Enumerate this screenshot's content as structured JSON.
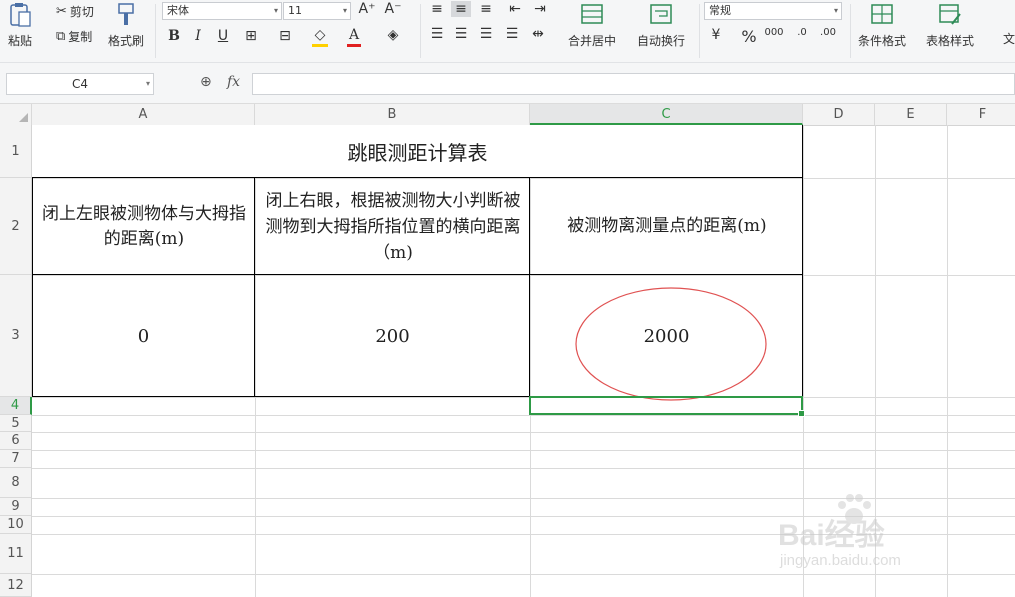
{
  "ribbon": {
    "paste": "粘贴",
    "cut": "剪切",
    "copy": "复制",
    "format_painter": "格式刷",
    "font_name": "宋体",
    "font_size": "11",
    "merge_center": "合并居中",
    "wrap_text": "自动换行",
    "number_format": "常规",
    "conditional_format": "条件格式",
    "table_style": "表格样式",
    "text_partial": "文",
    "bold": "B",
    "italic": "I",
    "underline": "U",
    "percent": "%",
    "font_grow": "A⁺",
    "font_shrink": "A⁻"
  },
  "formula_bar": {
    "cell_ref": "C4",
    "fx": "fx",
    "content": ""
  },
  "columns": [
    "A",
    "B",
    "C",
    "D",
    "E",
    "F"
  ],
  "rows": [
    "1",
    "2",
    "3",
    "4",
    "5",
    "6",
    "7",
    "8",
    "9",
    "10",
    "11",
    "12"
  ],
  "sheet": {
    "title": "跳眼测距计算表",
    "header_a": "闭上左眼被测物体与大拇指的距离(m)",
    "header_b": "闭上右眼，根据被测物大小判断被测物到大拇指所指位置的横向距离（m)",
    "header_c": "被测物离测量点的距离(m)",
    "value_a": "0",
    "value_b": "200",
    "value_c": "2000"
  },
  "watermark": {
    "brand": "Bai经验",
    "url": "jingyan.baidu.com"
  },
  "colors": {
    "selection": "#2e9a46",
    "annotation_circle": "#e05252",
    "active_header": "#2e9a46"
  }
}
